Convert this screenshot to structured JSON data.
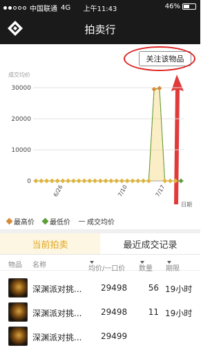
{
  "status_bar": {
    "carrier": "中国联通",
    "network": "4G",
    "time": "上午11:43",
    "battery": "46%"
  },
  "nav": {
    "title": "拍卖行",
    "logo_icon": "diamond-logo-icon"
  },
  "follow_button": {
    "label": "关注该物品"
  },
  "chart_data": {
    "type": "line",
    "ylabel": "成交均价",
    "xlabel": "日期",
    "ylim": [
      0,
      30000
    ],
    "y_ticks": [
      "0",
      "10000",
      "20000",
      "30000"
    ],
    "x_tick_labels": [
      "6/26",
      "7/10",
      "7/17"
    ],
    "series": [
      {
        "name": "最高价",
        "color": "#d98b3a",
        "values": [
          0,
          0,
          0,
          0,
          0,
          0,
          0,
          0,
          0,
          0,
          0,
          0,
          0,
          0,
          0,
          0,
          0,
          0,
          0,
          0,
          0,
          0,
          29498,
          29800,
          0,
          0,
          0,
          0
        ]
      },
      {
        "name": "最低价",
        "color": "#5a9e3a",
        "values": [
          0,
          0,
          0,
          0,
          0,
          0,
          0,
          0,
          0,
          0,
          0,
          0,
          0,
          0,
          0,
          0,
          0,
          0,
          0,
          0,
          0,
          0,
          29498,
          29800,
          0,
          0,
          0,
          0
        ]
      }
    ]
  },
  "legend": {
    "max_label": "最高价",
    "min_label": "最低价",
    "avg_label": "成交均价"
  },
  "tabs": {
    "current": "当前拍卖",
    "recent": "最近成交记录"
  },
  "table": {
    "headers": {
      "item": "物品",
      "name": "名称",
      "price": "均价/一口价",
      "qty": "数量",
      "expire": "期限"
    },
    "rows": [
      {
        "name": "深渊派对挑...",
        "price": "29498",
        "qty": "56",
        "expire": "19小时"
      },
      {
        "name": "深渊派对挑...",
        "price": "29498",
        "qty": "11",
        "expire": "19小时"
      },
      {
        "name": "深渊派对挑...",
        "price": "29499",
        "qty": "",
        "expire": ""
      }
    ]
  }
}
